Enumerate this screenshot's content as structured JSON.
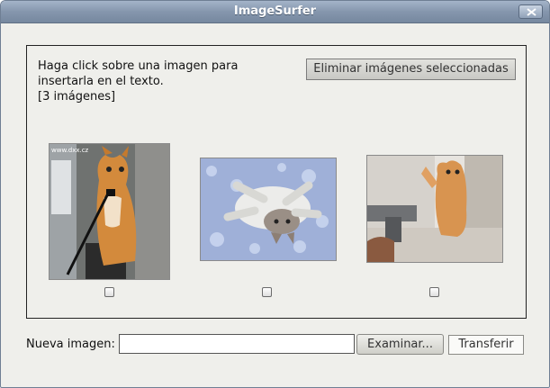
{
  "window": {
    "title": "ImageSurfer"
  },
  "panel": {
    "instructions_line1": "Haga click sobre una imagen para",
    "instructions_line2": "insertarla en el texto.",
    "image_count": "[3 imágenes]",
    "delete_button_label": "Eliminar imágenes seleccionadas"
  },
  "images": [
    {
      "icon": "kitten-holding-camera-image",
      "watermark": "www.dxx.cz",
      "checked": false
    },
    {
      "icon": "kitten-lying-on-back-image",
      "checked": false
    },
    {
      "icon": "kitten-with-gun-image",
      "checked": false
    }
  ],
  "upload": {
    "label": "Nueva imagen:",
    "value": "",
    "browse_label": "Examinar...",
    "transfer_label": "Transferir"
  }
}
